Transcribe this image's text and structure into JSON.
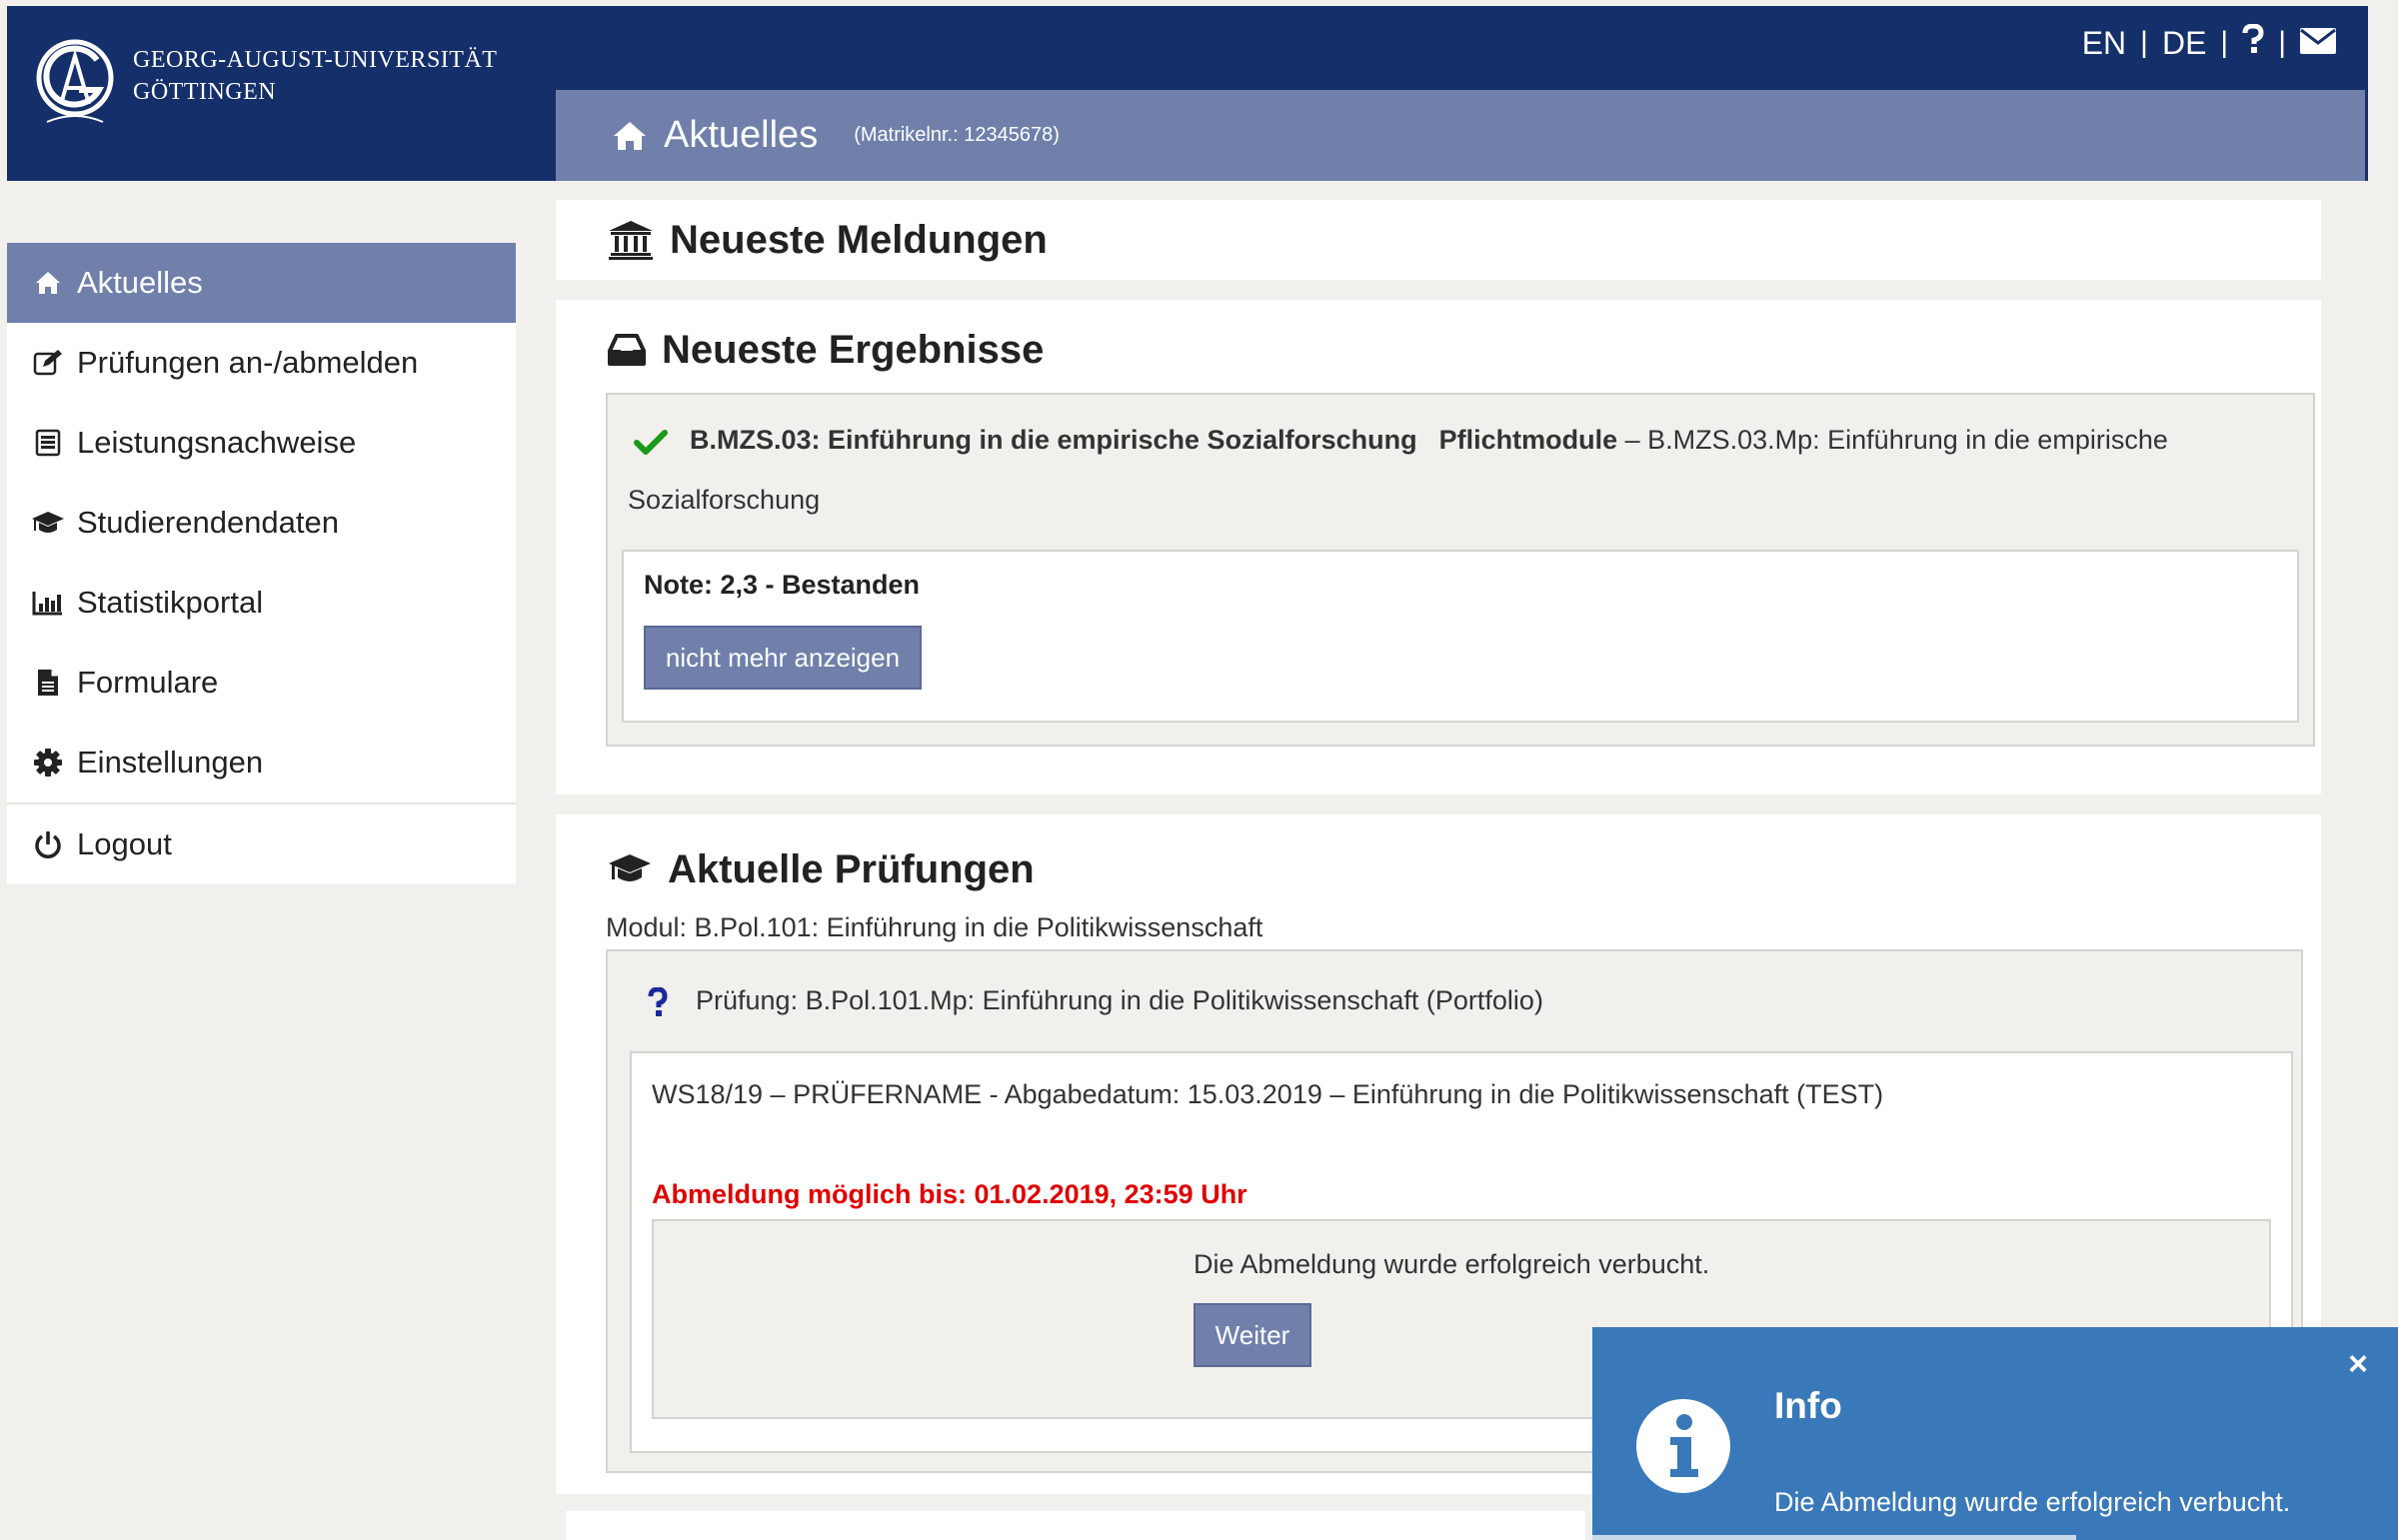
{
  "header": {
    "university_line1": "GEORG-AUGUST-UNIVERSITÄT",
    "university_line2": "GÖTTINGEN",
    "lang_en": "EN",
    "lang_de": "DE",
    "sep": "|",
    "help_icon": "question-icon",
    "mail_icon": "envelope-icon"
  },
  "titlebar": {
    "title": "Aktuelles",
    "matrikel": "(Matrikelnr.: 12345678)"
  },
  "sidebar": {
    "items": [
      {
        "label": "Aktuelles",
        "icon": "home-icon",
        "active": true
      },
      {
        "label": "Prüfungen an-/abmelden",
        "icon": "edit-icon"
      },
      {
        "label": "Leistungsnachweise",
        "icon": "list-icon"
      },
      {
        "label": "Studierendendaten",
        "icon": "graduation-cap-icon"
      },
      {
        "label": "Statistikportal",
        "icon": "bar-chart-icon"
      },
      {
        "label": "Formulare",
        "icon": "file-icon"
      },
      {
        "label": "Einstellungen",
        "icon": "gear-icon"
      },
      {
        "label": "Logout",
        "icon": "power-icon"
      }
    ]
  },
  "meldungen": {
    "title": "Neueste Meldungen"
  },
  "ergebnisse": {
    "title": "Neueste Ergebnisse",
    "module_code": "B.MZS.03: Einführung in die empirische Sozialforschung",
    "category": "Pflichtmodule",
    "detail_line1": " – B.MZS.03.Mp: Einführung in die empirische",
    "detail_line2": "Sozialforschung",
    "note": "Note:  2,3 - Bestanden",
    "hide_button": "nicht mehr anzeigen"
  },
  "pruefungen": {
    "title": "Aktuelle Prüfungen",
    "modul": "Modul: B.Pol.101: Einführung in die Politikwissenschaft",
    "pruefung": "Prüfung: B.Pol.101.Mp: Einführung in die Politikwissenschaft (Portfolio)",
    "details": "WS18/19 – PRÜFERNAME - Abgabedatum: 15.03.2019 – Einführung in die Politikwissenschaft (TEST)",
    "deadline": "Abmeldung möglich bis: 01.02.2019, 23:59 Uhr",
    "confirm_message": "Die Abmeldung wurde erfolgreich verbucht.",
    "next_button": "Weiter"
  },
  "toast": {
    "title": "Info",
    "message": "Die Abmeldung wurde erfolgreich verbucht.",
    "close": "×"
  },
  "colors": {
    "header_bg": "#152f6b",
    "accent": "#7080ab",
    "toast_bg": "#3a79b9",
    "deadline_red": "#e00000",
    "check_green": "#1a9a1a"
  }
}
